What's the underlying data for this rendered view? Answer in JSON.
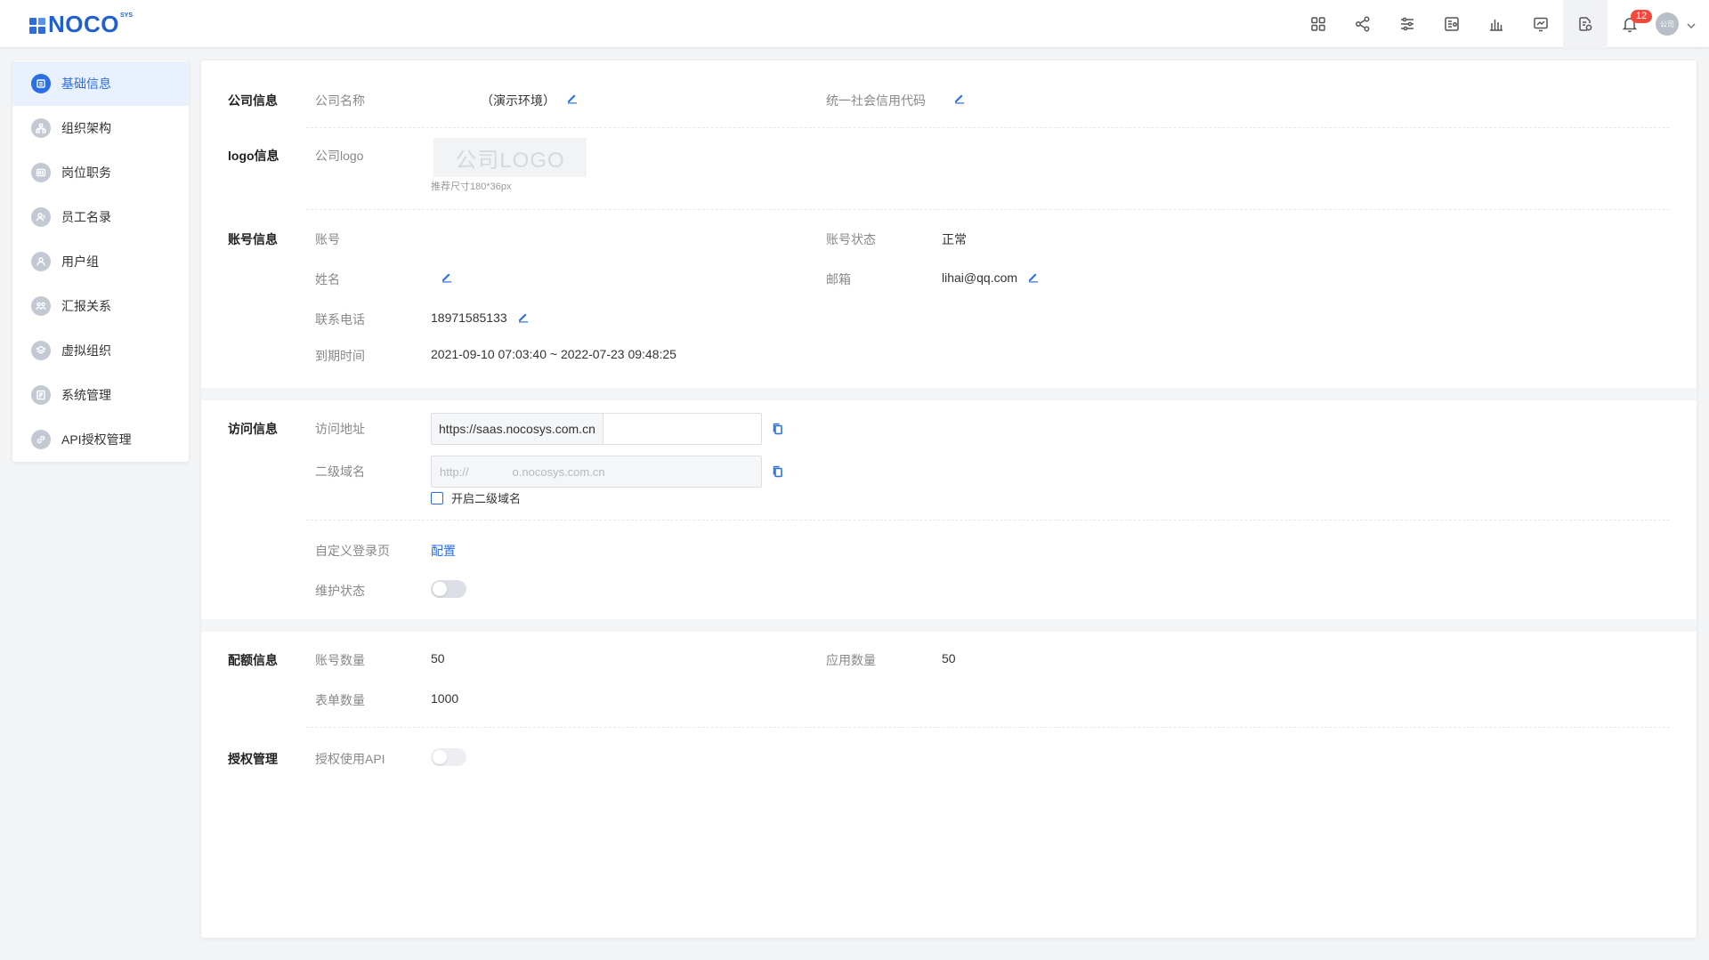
{
  "header": {
    "logo_text": "NOCO",
    "logo_sup": "SYS",
    "notification_count": "12",
    "avatar_text": "公司",
    "icons": [
      "apps-icon",
      "share-icon",
      "sliders-icon",
      "report-icon",
      "chart-icon",
      "monitor-chart-icon",
      "document-settings-icon",
      "bell-icon"
    ]
  },
  "sidebar": {
    "items": [
      {
        "label": "基础信息",
        "icon": "info-icon",
        "active": true
      },
      {
        "label": "组织架构",
        "icon": "org-icon",
        "active": false
      },
      {
        "label": "岗位职务",
        "icon": "position-icon",
        "active": false
      },
      {
        "label": "员工名录",
        "icon": "employee-icon",
        "active": false
      },
      {
        "label": "用户组",
        "icon": "user-group-icon",
        "active": false
      },
      {
        "label": "汇报关系",
        "icon": "report-relation-icon",
        "active": false
      },
      {
        "label": "虚拟组织",
        "icon": "layers-icon",
        "active": false
      },
      {
        "label": "系统管理",
        "icon": "system-icon",
        "active": false
      },
      {
        "label": "API授权管理",
        "icon": "link-icon",
        "active": false
      }
    ]
  },
  "company": {
    "title": "公司信息",
    "name_label": "公司名称",
    "name_value": "（演示环境）",
    "credit_label": "统一社会信用代码",
    "credit_value": ""
  },
  "logo_info": {
    "title": "logo信息",
    "label": "公司logo",
    "placeholder": "公司LOGO",
    "hint": "推荐尺寸180*36px"
  },
  "account": {
    "title": "账号信息",
    "account_label": "账号",
    "account_value": "",
    "status_label": "账号状态",
    "status_value": "正常",
    "name_label": "姓名",
    "name_value": "",
    "email_label": "邮箱",
    "email_value": "lihai@qq.com",
    "phone_label": "联系电话",
    "phone_value": "18971585133",
    "expire_label": "到期时间",
    "expire_value": "2021-09-10 07:03:40 ~ 2022-07-23 09:48:25"
  },
  "access": {
    "title": "访问信息",
    "url_label": "访问地址",
    "url_prefix": "https://saas.nocosys.com.cn",
    "url_value": "",
    "subdomain_label": "二级域名",
    "subdomain_prefix": "http://",
    "subdomain_suffix": "o.nocosys.com.cn",
    "enable_subdomain_label": "开启二级域名",
    "custom_login_label": "自定义登录页",
    "custom_login_link": "配置",
    "maintenance_label": "维护状态",
    "maintenance_on": false
  },
  "quota": {
    "title": "配额信息",
    "accounts_label": "账号数量",
    "accounts_value": "50",
    "apps_label": "应用数量",
    "apps_value": "50",
    "forms_label": "表单数量",
    "forms_value": "1000"
  },
  "auth": {
    "title": "授权管理",
    "api_label": "授权使用API",
    "api_on": false
  }
}
